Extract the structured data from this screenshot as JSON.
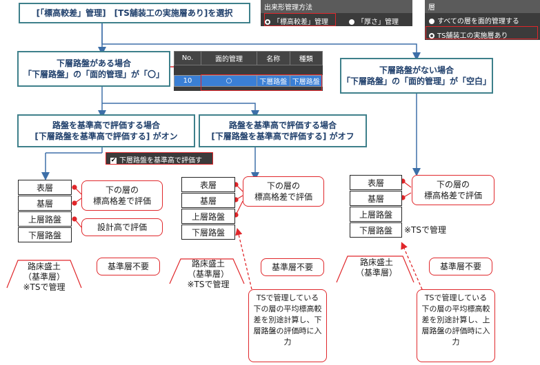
{
  "top_box": "[「標高較差」管理]　[TS舗装工の実施層あり]を選択",
  "method_panel": {
    "title": "出来形管理方法",
    "option_selected": "「標高較差」管理",
    "option_other": "「厚さ」管理"
  },
  "layer_panel": {
    "title": "層",
    "option1": "すべての層を面的管理する",
    "option2": "TS舗装工の実施層あり"
  },
  "box_with_base": "下層路盤がある場合\n「下層路盤」の「面的管理」が「〇」",
  "box_without_base": "下層路盤がない場合\n「下層路盤」の「面的管理」が「空白」",
  "table": {
    "headers": [
      "No.",
      "面的管理",
      "名称",
      "種類"
    ],
    "row": [
      "10",
      "○",
      "下層路盤",
      "下層路盤"
    ]
  },
  "box_eval_on": "路盤を基準高で評価する場合\n[下層路盤を基準高で評価する] がオン",
  "box_eval_off": "路盤を基準高で評価する場合\n[下層路盤を基準高で評価する] がオフ",
  "checkbox_label": "下層路盤を基準高で評価する",
  "col1": {
    "layers": [
      "表層",
      "基層",
      "上層路盤",
      "下層路盤"
    ],
    "bubble1": "下の層の\n標高格差で評価",
    "bubble2": "設計高で評価",
    "ground": "路床盛土\n（基準層）\n※TSで管理",
    "no_base": "基準層不要"
  },
  "col2": {
    "layers": [
      "表層",
      "基層",
      "上層路盤",
      "下層路盤"
    ],
    "bubble1": "下の層の\n標高格差で評価",
    "ground": "路床盛土\n（基準層）\n※TSで管理",
    "no_base": "基準層不要",
    "note": "TSで管理している下の層の平均標高較差を別途計算し、下層路盤の評価時に入力"
  },
  "col3": {
    "layers": [
      "表層",
      "基層",
      "上層路盤",
      "下層路盤"
    ],
    "bubble1": "下の層の\n標高格差で評価",
    "ts_note": "※TSで管理",
    "ground": "路床盛土\n（基準層）",
    "no_base": "基準層不要",
    "note": "TSで管理している下の層の平均標高較差を別途計算し、上層路盤の評価時に入力"
  }
}
